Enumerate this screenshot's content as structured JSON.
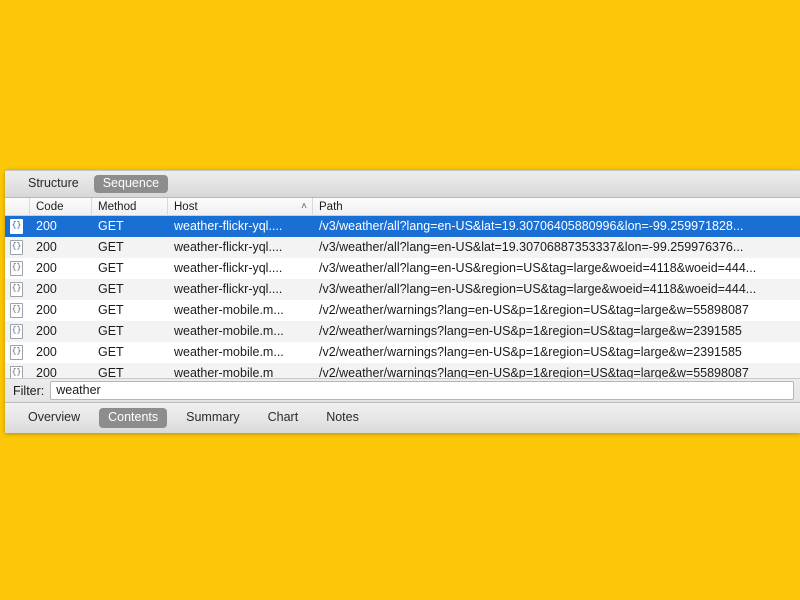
{
  "background": {
    "color": "#fcc706"
  },
  "theme": {
    "selection_blue": "#1a6fd4",
    "pill_gray": "#8d8d8d",
    "row_stripe": "#f3f3f3"
  },
  "top_tabs": [
    {
      "label": "Structure",
      "selected": false
    },
    {
      "label": "Sequence",
      "selected": true
    }
  ],
  "table": {
    "columns": [
      {
        "key": "icon",
        "label": ""
      },
      {
        "key": "code",
        "label": "Code"
      },
      {
        "key": "method",
        "label": "Method"
      },
      {
        "key": "host",
        "label": "Host",
        "sort_caret": "˄"
      },
      {
        "key": "path",
        "label": "Path"
      }
    ],
    "rows": [
      {
        "icon": "json-document-icon",
        "icon_glyph": "{}",
        "code": "200",
        "method": "GET",
        "host": "weather-flickr-yql....",
        "path": "/v3/weather/all?lang=en-US&lat=19.30706405880996&lon=-99.259971828...",
        "selected": true
      },
      {
        "icon": "json-document-icon",
        "icon_glyph": "{}",
        "code": "200",
        "method": "GET",
        "host": "weather-flickr-yql....",
        "path": "/v3/weather/all?lang=en-US&lat=19.30706887353337&lon=-99.259976376...",
        "selected": false
      },
      {
        "icon": "json-document-icon",
        "icon_glyph": "{}",
        "code": "200",
        "method": "GET",
        "host": "weather-flickr-yql....",
        "path": "/v3/weather/all?lang=en-US&region=US&tag=large&woeid=4118&woeid=444...",
        "selected": false
      },
      {
        "icon": "json-document-icon",
        "icon_glyph": "{}",
        "code": "200",
        "method": "GET",
        "host": "weather-flickr-yql....",
        "path": "/v3/weather/all?lang=en-US&region=US&tag=large&woeid=4118&woeid=444...",
        "selected": false
      },
      {
        "icon": "json-document-icon",
        "icon_glyph": "{}",
        "code": "200",
        "method": "GET",
        "host": "weather-mobile.m...",
        "path": "/v2/weather/warnings?lang=en-US&p=1&region=US&tag=large&w=55898087",
        "selected": false
      },
      {
        "icon": "json-document-icon",
        "icon_glyph": "{}",
        "code": "200",
        "method": "GET",
        "host": "weather-mobile.m...",
        "path": "/v2/weather/warnings?lang=en-US&p=1&region=US&tag=large&w=2391585",
        "selected": false
      },
      {
        "icon": "json-document-icon",
        "icon_glyph": "{}",
        "code": "200",
        "method": "GET",
        "host": "weather-mobile.m...",
        "path": "/v2/weather/warnings?lang=en-US&p=1&region=US&tag=large&w=2391585",
        "selected": false
      },
      {
        "icon": "json-document-icon",
        "icon_glyph": "{}",
        "code": "200",
        "method": "GET",
        "host": "weather-mobile.m",
        "path": "/v2/weather/warnings?lang=en-US&p=1&region=US&tag=large&w=55898087",
        "selected": false
      }
    ]
  },
  "filter": {
    "label": "Filter:",
    "value": "weather",
    "placeholder": ""
  },
  "bottom_tabs": [
    {
      "label": "Overview",
      "selected": false
    },
    {
      "label": "Contents",
      "selected": true
    },
    {
      "label": "Summary",
      "selected": false
    },
    {
      "label": "Chart",
      "selected": false
    },
    {
      "label": "Notes",
      "selected": false
    }
  ]
}
